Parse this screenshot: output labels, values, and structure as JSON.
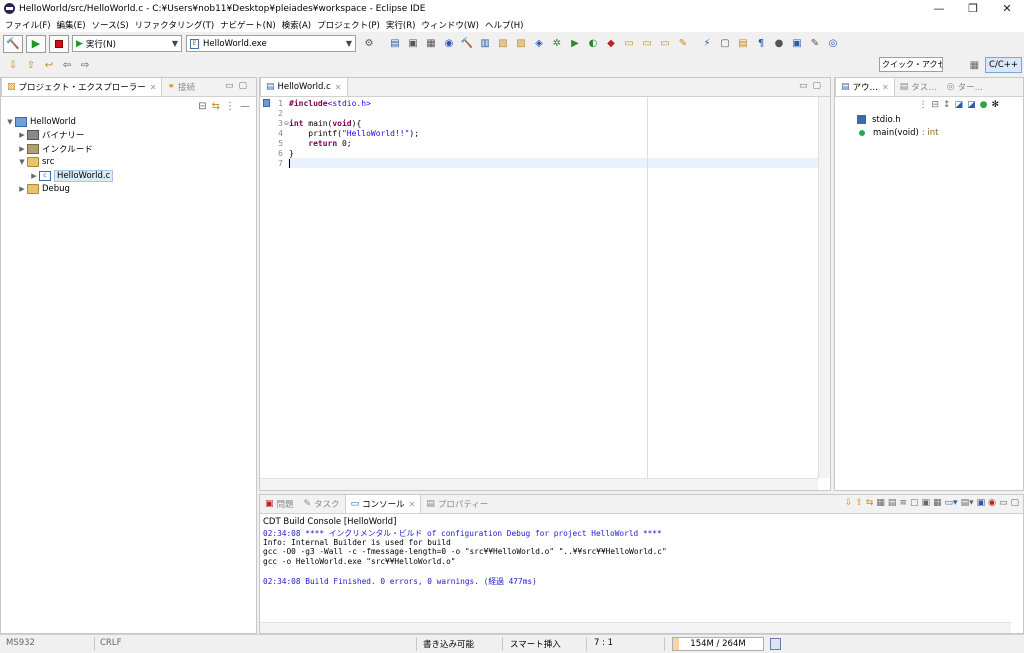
{
  "window": {
    "title": "HelloWorld/src/HelloWorld.c - C:¥Users¥nob11¥Desktop¥pleiades¥workspace - Eclipse IDE",
    "minimize": "—",
    "maximize": "❐",
    "close": "✕"
  },
  "menu": [
    "ファイル(F)",
    "編集(E)",
    "ソース(S)",
    "リファクタリング(T)",
    "ナビゲート(N)",
    "検索(A)",
    "プロジェクト(P)",
    "実行(R)",
    "ウィンドウ(W)",
    "ヘルプ(H)"
  ],
  "toolbar": {
    "launch_mode": "実行(N)",
    "launch_target": "HelloWorld.exe",
    "quick_access": "クイック・アクセス",
    "perspective": "C/C++"
  },
  "explorer": {
    "tabs": [
      "プロジェクト・エクスプローラー",
      "接続"
    ],
    "tree": {
      "project": "HelloWorld",
      "binaries": "バイナリー",
      "includes": "インクルード",
      "src": "src",
      "file": "HelloWorld.c",
      "debug": "Debug"
    }
  },
  "editor": {
    "tab": "HelloWorld.c",
    "line_numbers": [
      "1",
      "2",
      "3",
      "4",
      "5",
      "6",
      "7"
    ],
    "code": {
      "l1_kw": "#include",
      "l1_str": "<stdio.h>",
      "l3_kw1": "int",
      "l3_rest": " main(",
      "l3_kw2": "void",
      "l3_end": "){",
      "l4_fn": "    printf(",
      "l4_str": "\"HelloWorld!!\"",
      "l4_end": ");",
      "l5_kw": "    return",
      "l5_rest": " 0;",
      "l6": "}"
    }
  },
  "outline": {
    "tabs": [
      "アウ…",
      "タス…",
      "ター…"
    ],
    "items": [
      {
        "label": "stdio.h",
        "type": ""
      },
      {
        "label": "main(void)",
        "type": ": int"
      }
    ]
  },
  "console": {
    "tabs": [
      "問題",
      "タスク",
      "コンソール",
      "プロパティー"
    ],
    "title": "CDT Build Console [HelloWorld]",
    "lines": [
      "02:34:08 **** インクリメンタル・ビルド of configuration Debug for project HelloWorld ****",
      "Info: Internal Builder is used for build",
      "gcc -O0 -g3 -Wall -c -fmessage-length=0 -o \"src¥¥HelloWorld.o\" \"..¥¥src¥¥HelloWorld.c\"",
      "gcc -o HelloWorld.exe \"src¥¥HelloWorld.o\"",
      "",
      "02:34:08 Build Finished. 0 errors, 0 warnings. (経過 477ms)"
    ],
    "blue_lines": [
      0,
      5
    ]
  },
  "status": {
    "left1": "MS932",
    "left2": "CRLF",
    "writable": "書き込み可能",
    "insert_mode": "スマート挿入",
    "position": "7 : 1",
    "heap": "154M / 264M",
    "heap_used_fraction": 0.0625
  },
  "colors": {
    "keyword": "#7f0055",
    "string": "#2a00ff",
    "console_info": "#1a1ad0"
  }
}
